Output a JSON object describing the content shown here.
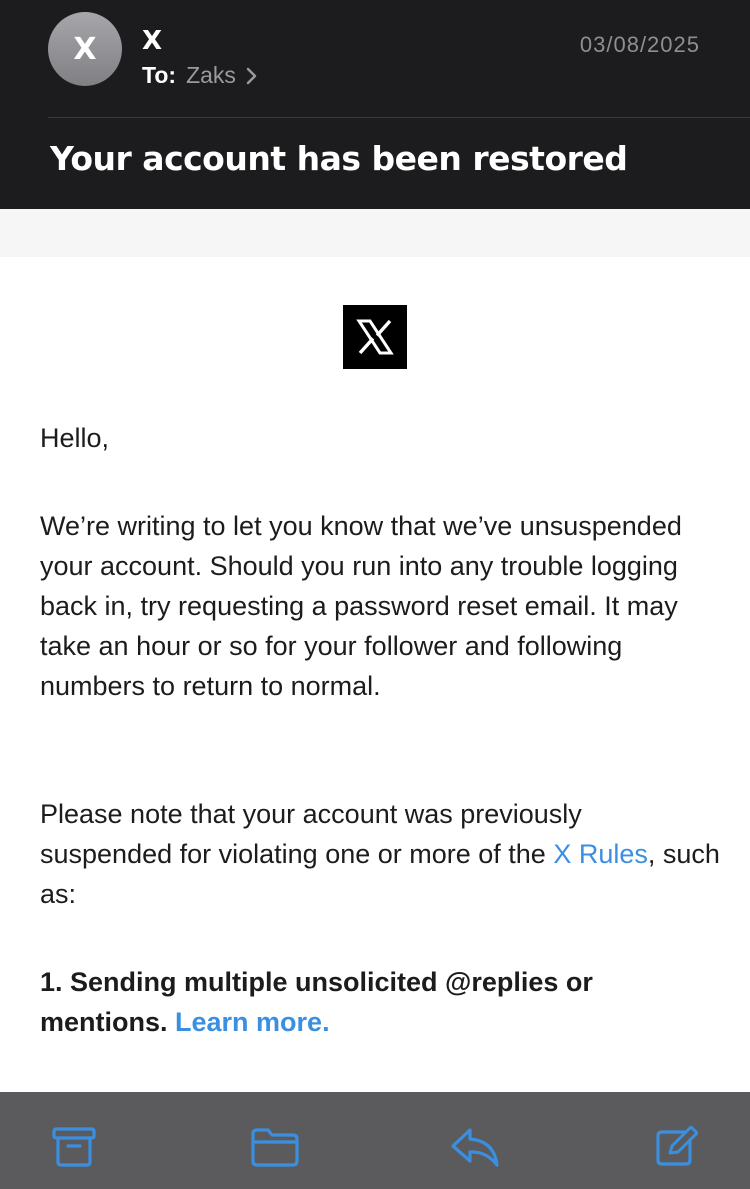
{
  "header": {
    "avatar_initial": "X",
    "sender": "X",
    "to_label": "To:",
    "to_name": "Zaks",
    "date": "03/08/2025",
    "subject": "Your account has been restored"
  },
  "email": {
    "greeting": "Hello,",
    "paragraph1": "We’re writing to let you know that we’ve unsuspended your account. Should you run into any trouble logging back in, try requesting a password reset email. It may take an hour or so for your follower and following numbers to return to normal.",
    "paragraph2_before": "Please note that your account was previously suspended for violating one or more of the ",
    "paragraph2_link": "X Rules",
    "paragraph2_after": ", such as:",
    "violation_text": "1. Sending multiple unsolicited @replies or mentions. ",
    "violation_link": "Learn more."
  },
  "toolbar": {
    "icons": [
      "archive-icon",
      "folder-icon",
      "reply-icon",
      "compose-icon"
    ]
  },
  "colors": {
    "header_bg": "#1c1c1e",
    "link": "#3a8fe0",
    "toolbar_bg": "#5b5b5e",
    "toolbar_icon": "#3a8fe0"
  }
}
